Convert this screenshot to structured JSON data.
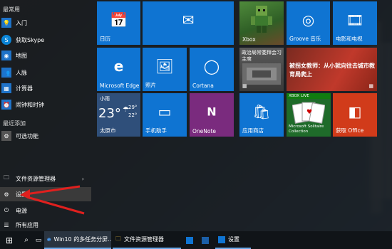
{
  "left_panel": {
    "section_frequent": "最常用",
    "items": [
      {
        "label": "入门",
        "icon": "lightbulb-icon"
      },
      {
        "label": "获取Skype",
        "icon": "skype-icon"
      },
      {
        "label": "地图",
        "icon": "map-icon"
      },
      {
        "label": "人脉",
        "icon": "people-icon"
      },
      {
        "label": "计算器",
        "icon": "calculator-icon"
      },
      {
        "label": "闹钟和时钟",
        "icon": "alarm-icon"
      }
    ],
    "section_recent": "最近添加",
    "recent_item": "可选功能",
    "bottom_items": [
      {
        "label": "文件资源管理器",
        "icon": "folder-icon"
      },
      {
        "label": "设置",
        "icon": "gear-icon"
      },
      {
        "label": "电源",
        "icon": "power-icon"
      },
      {
        "label": "所有应用",
        "icon": "all-apps-icon"
      }
    ],
    "chevron": "›"
  },
  "tiles": {
    "calendar": "日历",
    "mail_label": "",
    "xbox": "Xbox",
    "groove": "Groove 音乐",
    "movies": "电影和电视",
    "edge": "Microsoft Edge",
    "photos": "照片",
    "cortana": "Cortana",
    "news_headline": "政治局常委拜会习主席",
    "news2_headline": "被拐女教师：从小就向往去城市教育局爬上",
    "weather_city_label": "小雨",
    "weather_temp": "23°",
    "weather_hi": "29°",
    "weather_lo": "22°",
    "weather_city": "太原市",
    "phone": "手机助手",
    "onenote": "OneNote",
    "store": "应用商店",
    "solitaire_badge": "XBOX LIVE",
    "solitaire_caption": "Microsoft Solitaire Collection",
    "office": "获取 Office"
  },
  "taskbar": {
    "start_icon": "windows-icon",
    "search_icon": "search-icon",
    "taskview_icon": "task-view-icon",
    "edge_title": "Win10 的多任务分屏...",
    "explorer_title": "文件资源管理器",
    "settings_title": "设置"
  },
  "colors": {
    "tile_blue": "#0f74d2",
    "store_blue": "#0f74d2",
    "onenote_purple": "#7a2b7e",
    "office_orange": "#d13b1a",
    "arrow_red": "#e0201e"
  }
}
